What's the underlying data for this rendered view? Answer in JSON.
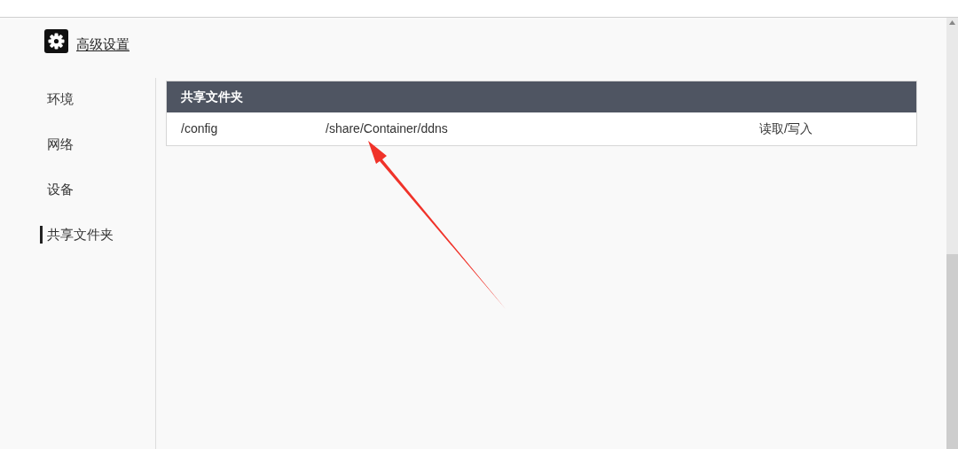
{
  "page": {
    "title": "高级设置"
  },
  "sidebar": {
    "items": [
      {
        "label": "环境",
        "selected": false
      },
      {
        "label": "网络",
        "selected": false
      },
      {
        "label": "设备",
        "selected": false
      },
      {
        "label": "共享文件夹",
        "selected": true
      }
    ]
  },
  "table": {
    "title": "共享文件夹",
    "rows": [
      {
        "cells": [
          "/config",
          "/share/Container/ddns",
          "读取/写入"
        ]
      }
    ]
  }
}
